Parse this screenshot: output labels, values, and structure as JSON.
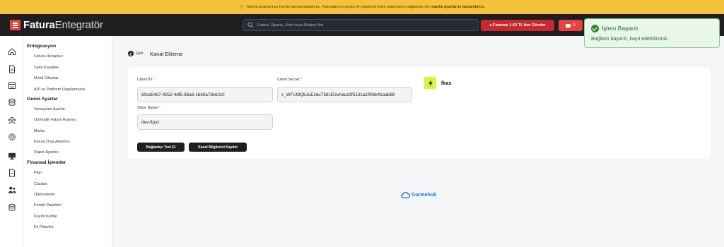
{
  "banner": {
    "text_before": "Marka ayarlarınızı henüz tamamlamadınız. Faturaların e-posta ile müşterilerinize ulaşmasını sağlamak için",
    "text_bold": "marka ayarlarını tamamlayın."
  },
  "header": {
    "logo_bold": "Fatura",
    "logo_light": "Entegratör",
    "search_placeholder": "Fatura, Sipariş, Ürün veya Müşteri Ara",
    "credit_button": "e-Faturanı 1.63 TL'den Gönder",
    "notification_count": "0"
  },
  "toast": {
    "title": "İşlem Başarılı",
    "message": "Bağlantı başarılı, kayıt edebilirsiniz."
  },
  "rail_icons": [
    "home-icon",
    "document-icon",
    "inbox-icon",
    "database-icon",
    "users-group-icon",
    "gear-icon",
    "monitor-icon",
    "invoice-icon",
    "people-icon",
    "archive-icon"
  ],
  "sidebar": {
    "sections": [
      {
        "title": "Entegrasyon",
        "items": [
          "Fatura Hesapları",
          "Satış Kanalları",
          "Mobil Cihazlar",
          "API ve Platform Uygulamaları"
        ]
      },
      {
        "title": "Genel Ayarlar",
        "items": [
          "Varsayılan Ayarlar",
          "Otomatik Fatura Ayarları",
          "Marka",
          "Fatura Dışa Aktarma",
          "Rapor Ayarları"
        ]
      },
      {
        "title": "Finansal İşlemler",
        "items": [
          "Plan",
          "Cüzdan",
          "Ödemelerim",
          "Kontör Paketleri",
          "Kayıtlı Kartlar",
          "Ek Paketler"
        ]
      }
    ]
  },
  "page": {
    "back_label": "Geri",
    "title": "Kanal Ekleme"
  },
  "form": {
    "client_id_label": "Client ID",
    "client_id_value": "60ca54d7-4252-4df5-86a3-1b60a7dc62c0",
    "client_secret_label": "Client Secret",
    "client_secret_value": "s_WFUt8QbJuEzduT58UDsvhauz2f5131a240bb41aab88",
    "store_name_label": "Store Name",
    "store_name_value": "dev-ftpyz",
    "required_mark": "*",
    "test_button": "Bağlantıyı Test Et",
    "save_button": "Kanal Bilgilerini Kaydet",
    "brand_name": "İkas"
  },
  "footer": {
    "brand": "Gurmehub"
  },
  "colors": {
    "banner_bg": "#f5c33b",
    "topbar_bg": "#1f1f1f",
    "brand_red": "#e8423f",
    "toast_bg": "#eaf6ea",
    "success_green": "#2e8b3e",
    "ikas_yellow": "#d7f53a",
    "gurmehub_blue": "#1e72d8"
  }
}
